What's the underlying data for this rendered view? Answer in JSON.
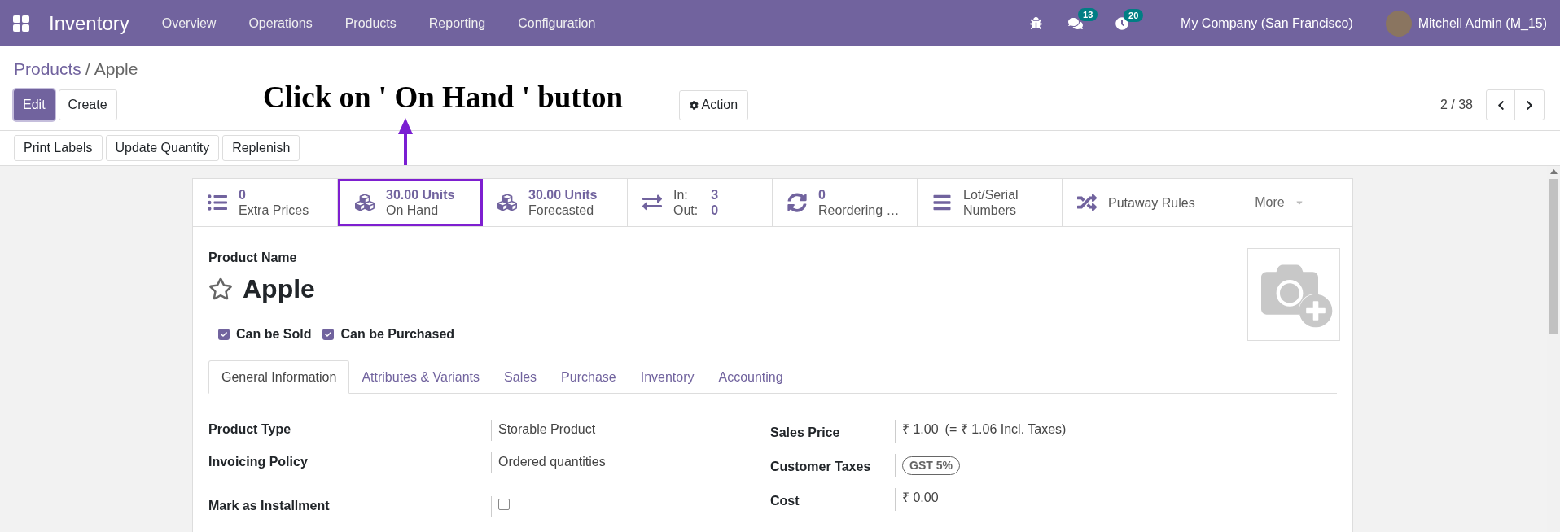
{
  "navbar": {
    "app_name": "Inventory",
    "menu": [
      "Overview",
      "Operations",
      "Products",
      "Reporting",
      "Configuration"
    ],
    "chat_count": "13",
    "activity_count": "20",
    "company": "My Company (San Francisco)",
    "user": "Mitchell Admin (M_15)"
  },
  "breadcrumb": {
    "parent": "Products",
    "separator": "/",
    "current": "Apple"
  },
  "buttons": {
    "edit": "Edit",
    "create": "Create",
    "action": "Action"
  },
  "pager": "2 / 38",
  "toolbar": [
    "Print Labels",
    "Update Quantity",
    "Replenish"
  ],
  "annotation": "Click on ' On Hand ' button",
  "stat_buttons": [
    {
      "kind": "value",
      "value": "0",
      "label": "Extra Prices",
      "highlighted": false
    },
    {
      "kind": "value",
      "value": "30.00 Units",
      "label": "On Hand",
      "highlighted": true
    },
    {
      "kind": "value",
      "value": "30.00 Units",
      "label": "Forecasted",
      "highlighted": false
    },
    {
      "kind": "inout",
      "in_label": "In:",
      "in_value": "3",
      "out_label": "Out:",
      "out_value": "0",
      "highlighted": false
    },
    {
      "kind": "value",
      "value": "0",
      "label": "Reordering …",
      "highlighted": false
    },
    {
      "kind": "text",
      "label": "Lot/Serial Numbers",
      "highlighted": false
    },
    {
      "kind": "text",
      "label": "Putaway Rules",
      "highlighted": false
    },
    {
      "kind": "more",
      "label": "More",
      "highlighted": false
    }
  ],
  "product": {
    "name_label": "Product Name",
    "name": "Apple",
    "favorite": false,
    "options": [
      {
        "label": "Can be Sold",
        "checked": true
      },
      {
        "label": "Can be Purchased",
        "checked": true
      }
    ]
  },
  "tabs": [
    {
      "label": "General Information",
      "selected": true
    },
    {
      "label": "Attributes & Variants",
      "selected": false
    },
    {
      "label": "Sales",
      "selected": false
    },
    {
      "label": "Purchase",
      "selected": false
    },
    {
      "label": "Inventory",
      "selected": false
    },
    {
      "label": "Accounting",
      "selected": false
    }
  ],
  "left_groups": [
    [
      {
        "kind": "text",
        "label": "Product Type",
        "value": "Storable Product"
      },
      {
        "kind": "text",
        "label": "Invoicing Policy",
        "value": "Ordered quantities"
      }
    ],
    [
      {
        "kind": "checkbox",
        "label": "Mark as Installment",
        "checked": false
      }
    ]
  ],
  "right_fields": [
    {
      "kind": "text",
      "label": "Sales Price",
      "value": "₹ 1.00",
      "note": "(= ₹ 1.06 Incl. Taxes)"
    },
    {
      "kind": "tags",
      "label": "Customer Taxes",
      "tags": [
        "GST 5%"
      ]
    },
    {
      "kind": "text",
      "label": "Cost",
      "value": "₹ 0.00"
    }
  ]
}
